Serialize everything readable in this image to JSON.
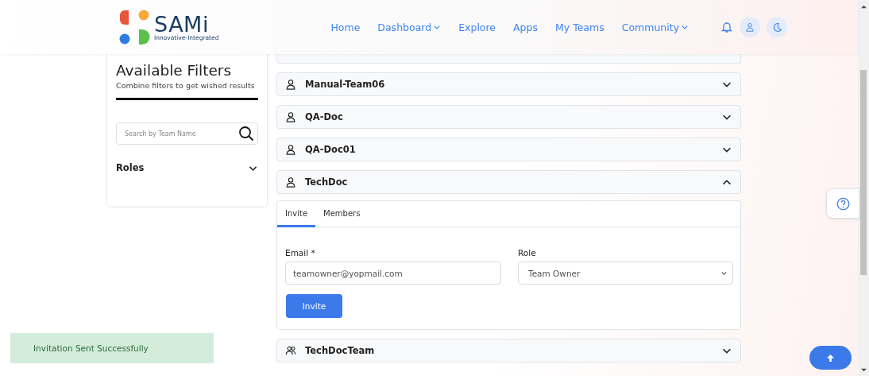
{
  "header": {
    "logo": {
      "name": "SAMi",
      "tagline": "Innovative-Integrated"
    },
    "nav": [
      {
        "label": "Home",
        "dropdown": false
      },
      {
        "label": "Dashboard",
        "dropdown": true
      },
      {
        "label": "Explore",
        "dropdown": false
      },
      {
        "label": "Apps",
        "dropdown": false
      },
      {
        "label": "My Teams",
        "dropdown": false
      },
      {
        "label": "Community",
        "dropdown": true
      }
    ]
  },
  "filters": {
    "title": "Available Filters",
    "subtitle": "Combine filters to get wished results",
    "search": {
      "placeholder": "Search by Team Name"
    },
    "sections": [
      {
        "label": "Roles",
        "expanded": false
      }
    ]
  },
  "teams": [
    {
      "kind": "clipped"
    },
    {
      "name": "Manual-Team06",
      "kind": "person",
      "expanded": false
    },
    {
      "name": "QA-Doc",
      "kind": "person",
      "expanded": false
    },
    {
      "name": "QA-Doc01",
      "kind": "person",
      "expanded": false
    },
    {
      "name": "TechDoc",
      "kind": "person",
      "expanded": true,
      "tabs": [
        {
          "label": "Invite",
          "selected": true
        },
        {
          "label": "Members",
          "selected": false
        }
      ],
      "form": {
        "email": {
          "label": "Email *",
          "value": "teamowner@yopmail.com"
        },
        "role": {
          "label": "Role",
          "value": "Team Owner"
        },
        "button": "Invite"
      }
    },
    {
      "name": "TechDocTeam",
      "kind": "group",
      "expanded": false
    }
  ],
  "toast": {
    "message": "Invitation Sent Successfully",
    "kind": "success"
  }
}
